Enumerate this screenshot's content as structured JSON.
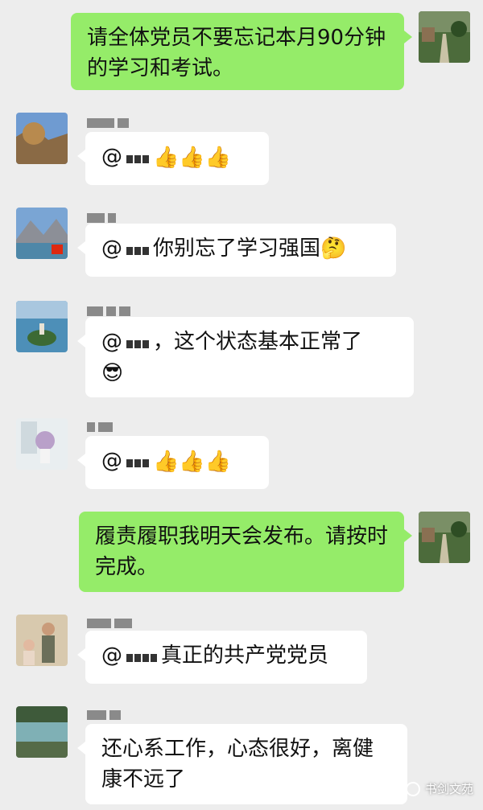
{
  "messages": [
    {
      "side": "me",
      "text": "请全体党员不要忘记本月90分钟的学习和考试。"
    },
    {
      "side": "other",
      "at": "@",
      "suffix": "👍👍👍"
    },
    {
      "side": "other",
      "at": "@",
      "suffix": "你别忘了学习强国🤔"
    },
    {
      "side": "other",
      "at": "@",
      "suffix": "，这个状态基本正常了",
      "line2": "😎"
    },
    {
      "side": "other",
      "at": "@",
      "suffix": "👍👍👍"
    },
    {
      "side": "me",
      "text": "履责履职我明天会发布。请按时完成。"
    },
    {
      "side": "other",
      "at": "@",
      "suffix": "真正的共产党党员"
    },
    {
      "side": "other",
      "text": "还心系工作，心态很好，离健康不远了"
    }
  ],
  "watermark": "书剑文苑",
  "colors": {
    "me_bubble": "#95ec69",
    "other_bubble": "#ffffff",
    "background": "#ededed"
  }
}
